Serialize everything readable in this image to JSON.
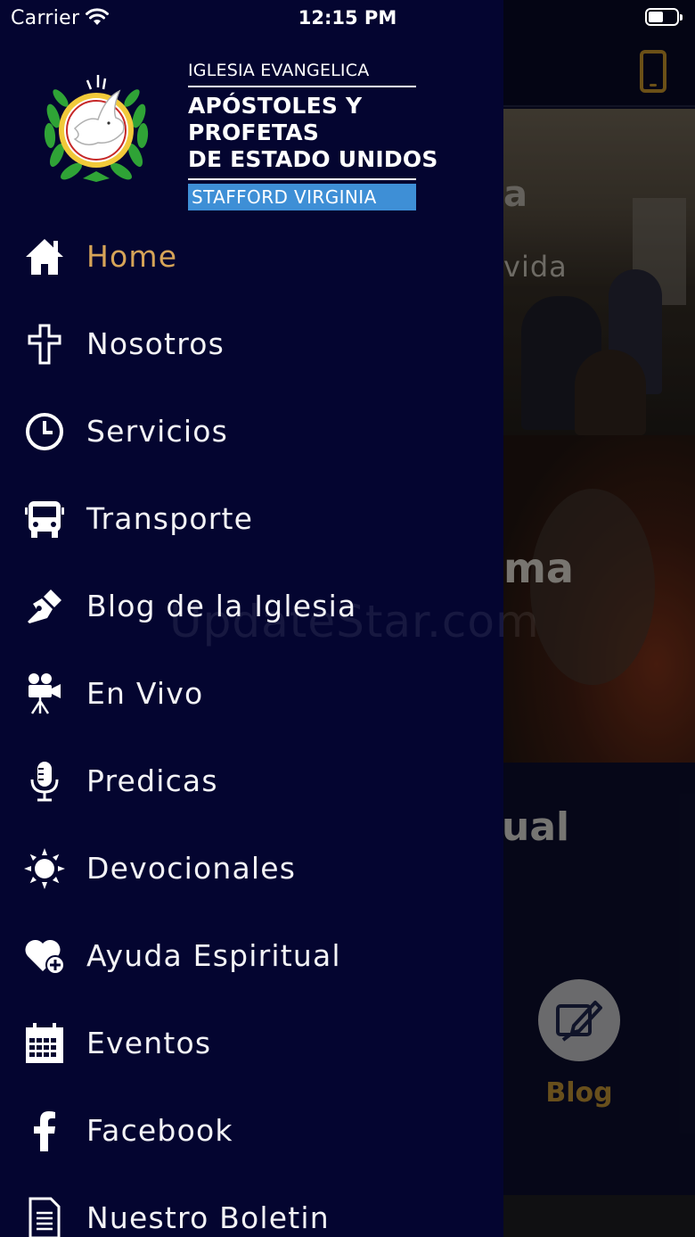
{
  "status_bar": {
    "carrier": "Carrier",
    "time": "12:15 PM",
    "icons": [
      "wifi-icon",
      "battery-icon"
    ]
  },
  "drawer": {
    "brand": {
      "line1": "IGLESIA EVANGELICA",
      "line2": "APÓSTOLES Y PROFETAS",
      "line3": "DE ESTADO UNIDOS",
      "place": "STAFFORD VIRGINIA",
      "accent_color": "#3e8fd6"
    },
    "menu": [
      {
        "label": "Home",
        "icon": "home-icon",
        "active": true
      },
      {
        "label": "Nosotros",
        "icon": "cross-icon",
        "active": false
      },
      {
        "label": "Servicios",
        "icon": "clock-icon",
        "active": false
      },
      {
        "label": "Transporte",
        "icon": "bus-icon",
        "active": false
      },
      {
        "label": "Blog de la Iglesia",
        "icon": "pen-icon",
        "active": false
      },
      {
        "label": "En Vivo",
        "icon": "video-camera-icon",
        "active": false
      },
      {
        "label": "Predicas",
        "icon": "microphone-icon",
        "active": false
      },
      {
        "label": "Devocionales",
        "icon": "sun-icon",
        "active": false
      },
      {
        "label": "Ayuda Espiritual",
        "icon": "heart-plus-icon",
        "active": false
      },
      {
        "label": "Eventos",
        "icon": "calendar-icon",
        "active": false
      },
      {
        "label": "Facebook",
        "icon": "facebook-icon",
        "active": false
      },
      {
        "label": "Nuestro Boletin",
        "icon": "document-icon",
        "active": false
      }
    ],
    "background_color": "#040530",
    "active_color": "#d6a458"
  },
  "background": {
    "snippet_a": "a",
    "snippet_vida": "vida",
    "snippet_ma": "ma",
    "snippet_ual": "ual",
    "blog_label": "Blog",
    "accent_color": "#a57c24"
  },
  "watermark": "UpdateStar.com"
}
